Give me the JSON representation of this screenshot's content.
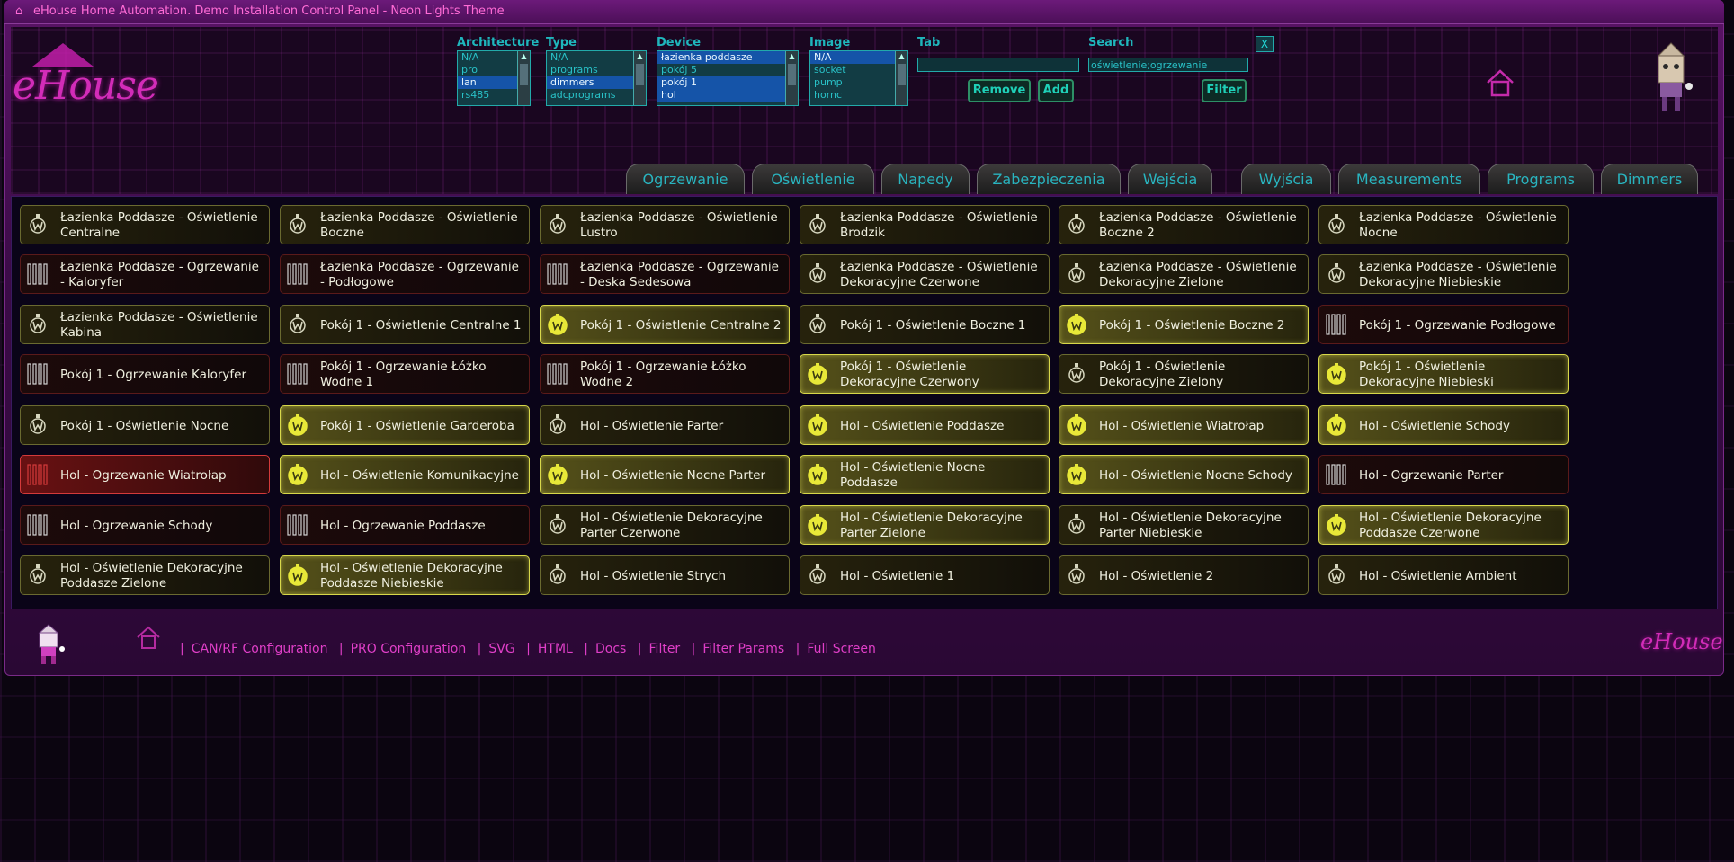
{
  "window": {
    "title": "eHouse Home Automation. Demo Installation Control Panel - Neon Lights Theme"
  },
  "logo": {
    "text": "eHouse"
  },
  "filters": {
    "architecture": {
      "label": "Architecture",
      "options": [
        "N/A",
        "pro",
        "lan",
        "rs485"
      ],
      "selected": "lan"
    },
    "type": {
      "label": "Type",
      "options": [
        "N/A",
        "programs",
        "dimmers",
        "adcprograms"
      ],
      "selected": "dimmers"
    },
    "device": {
      "label": "Device",
      "options": [
        "łazienka poddasze",
        "pokój 5",
        "pokój 1",
        "hol"
      ],
      "selected": [
        "łazienka poddasze",
        "pokój 1",
        "hol"
      ]
    },
    "image": {
      "label": "Image",
      "options": [
        "N/A",
        "socket",
        "pump",
        "hornc"
      ],
      "selected": "N/A"
    },
    "tab": {
      "label": "Tab",
      "value": ""
    },
    "search": {
      "label": "Search",
      "value": "oświetlenie;ogrzewanie"
    },
    "remove_label": "Remove",
    "add_label": "Add",
    "filter_label": "Filter",
    "close_label": "X"
  },
  "tabs": [
    {
      "label": "Ogrzewanie"
    },
    {
      "label": "Oświetlenie"
    },
    {
      "label": "Napedy"
    },
    {
      "label": "Zabezpieczenia"
    },
    {
      "label": "Wejścia"
    },
    {
      "label": "Wyjścia"
    },
    {
      "label": "Measurements"
    },
    {
      "label": "Programs"
    },
    {
      "label": "Dimmers"
    }
  ],
  "tiles": [
    {
      "label": "Łazienka Poddasze - Oświetlenie Centralne",
      "kind": "light",
      "state": "off"
    },
    {
      "label": "Łazienka Poddasze - Oświetlenie Boczne",
      "kind": "light",
      "state": "off"
    },
    {
      "label": "Łazienka Poddasze - Oświetlenie Lustro",
      "kind": "light",
      "state": "off"
    },
    {
      "label": "Łazienka Poddasze - Oświetlenie Brodzik",
      "kind": "light",
      "state": "off"
    },
    {
      "label": "Łazienka Poddasze - Oświetlenie Boczne 2",
      "kind": "light",
      "state": "off"
    },
    {
      "label": "Łazienka Poddasze - Oświetlenie Nocne",
      "kind": "light",
      "state": "off"
    },
    {
      "label": "Łazienka Poddasze - Ogrzewanie - Kaloryfer",
      "kind": "heat",
      "state": "off"
    },
    {
      "label": "Łazienka Poddasze - Ogrzewanie - Podłogowe",
      "kind": "heat",
      "state": "off"
    },
    {
      "label": "Łazienka Poddasze - Ogrzewanie - Deska Sedesowa",
      "kind": "heat",
      "state": "off"
    },
    {
      "label": "Łazienka Poddasze - Oświetlenie Dekoracyjne Czerwone",
      "kind": "light",
      "state": "off"
    },
    {
      "label": "Łazienka Poddasze - Oświetlenie Dekoracyjne Zielone",
      "kind": "light",
      "state": "off"
    },
    {
      "label": "Łazienka Poddasze - Oświetlenie Dekoracyjne Niebieskie",
      "kind": "light",
      "state": "off"
    },
    {
      "label": "Łazienka Poddasze - Oświetlenie Kabina",
      "kind": "light",
      "state": "off"
    },
    {
      "label": "Pokój 1 - Oświetlenie Centralne 1",
      "kind": "light",
      "state": "off"
    },
    {
      "label": "Pokój 1 - Oświetlenie Centralne 2",
      "kind": "light",
      "state": "on"
    },
    {
      "label": "Pokój 1 - Oświetlenie Boczne 1",
      "kind": "light",
      "state": "off"
    },
    {
      "label": "Pokój 1 - Oświetlenie Boczne 2",
      "kind": "light",
      "state": "on"
    },
    {
      "label": "Pokój 1 - Ogrzewanie Podłogowe",
      "kind": "heat",
      "state": "off"
    },
    {
      "label": "Pokój 1 - Ogrzewanie Kaloryfer",
      "kind": "heat",
      "state": "off"
    },
    {
      "label": "Pokój 1 - Ogrzewanie Łóżko Wodne 1",
      "kind": "heat",
      "state": "off"
    },
    {
      "label": "Pokój 1 - Ogrzewanie Łóżko Wodne 2",
      "kind": "heat",
      "state": "off"
    },
    {
      "label": "Pokój 1 - Oświetlenie Dekoracyjne Czerwony",
      "kind": "light",
      "state": "on"
    },
    {
      "label": "Pokój 1 - Oświetlenie Dekoracyjne Zielony",
      "kind": "light",
      "state": "off"
    },
    {
      "label": "Pokój 1 - Oświetlenie Dekoracyjne Niebieski",
      "kind": "light",
      "state": "on"
    },
    {
      "label": "Pokój 1 - Oświetlenie Nocne",
      "kind": "light",
      "state": "off"
    },
    {
      "label": "Pokój 1 - Oświetlenie Garderoba",
      "kind": "light",
      "state": "on"
    },
    {
      "label": "Hol - Oświetlenie Parter",
      "kind": "light",
      "state": "off"
    },
    {
      "label": "Hol - Oświetlenie Poddasze",
      "kind": "light",
      "state": "on"
    },
    {
      "label": "Hol - Oświetlenie Wiatrołap",
      "kind": "light",
      "state": "on"
    },
    {
      "label": "Hol - Oświetlenie Schody",
      "kind": "light",
      "state": "on"
    },
    {
      "label": "Hol - Ogrzewanie Wiatrołap",
      "kind": "heat",
      "state": "on"
    },
    {
      "label": "Hol - Oświetlenie Komunikacyjne",
      "kind": "light",
      "state": "on"
    },
    {
      "label": "Hol - Oświetlenie Nocne Parter",
      "kind": "light",
      "state": "on"
    },
    {
      "label": "Hol - Oświetlenie Nocne Poddasze",
      "kind": "light",
      "state": "on"
    },
    {
      "label": "Hol - Oświetlenie Nocne Schody",
      "kind": "light",
      "state": "on"
    },
    {
      "label": "Hol - Ogrzewanie Parter",
      "kind": "heat",
      "state": "off"
    },
    {
      "label": "Hol - Ogrzewanie Schody",
      "kind": "heat",
      "state": "off"
    },
    {
      "label": "Hol - Ogrzewanie Poddasze",
      "kind": "heat",
      "state": "off"
    },
    {
      "label": "Hol - Oświetlenie Dekoracyjne Parter Czerwone",
      "kind": "light",
      "state": "off"
    },
    {
      "label": "Hol - Oświetlenie Dekoracyjne Parter Zielone",
      "kind": "light",
      "state": "on"
    },
    {
      "label": "Hol - Oświetlenie Dekoracyjne Parter Niebieskie",
      "kind": "light",
      "state": "off"
    },
    {
      "label": "Hol - Oświetlenie Dekoracyjne Poddasze Czerwone",
      "kind": "light",
      "state": "on"
    },
    {
      "label": "Hol - Oświetlenie Dekoracyjne Poddasze Zielone",
      "kind": "light",
      "state": "off"
    },
    {
      "label": "Hol - Oświetlenie Dekoracyjne Poddasze Niebieskie",
      "kind": "light",
      "state": "on"
    },
    {
      "label": "Hol - Oświetlenie Strych",
      "kind": "light",
      "state": "off"
    },
    {
      "label": "Hol - Oświetlenie 1",
      "kind": "light",
      "state": "off"
    },
    {
      "label": "Hol - Oświetlenie 2",
      "kind": "light",
      "state": "off"
    },
    {
      "label": "Hol - Oświetlenie Ambient",
      "kind": "light",
      "state": "off"
    }
  ],
  "footer": {
    "links": [
      "CAN/RF Configuration",
      "PRO Configuration",
      "SVG",
      "HTML",
      "Docs",
      "Filter",
      "Filter Params",
      "Full Screen"
    ],
    "logo_text": "eHouse"
  },
  "colors": {
    "accent": "#e03fc8",
    "cyan": "#29c2c8",
    "light_on": "#e8e838",
    "heat_on": "#d43a3a"
  },
  "icons": {
    "light": "bulb-icon",
    "heat": "radiator-icon",
    "home": "home-icon",
    "mascot": "mascot-icon"
  }
}
